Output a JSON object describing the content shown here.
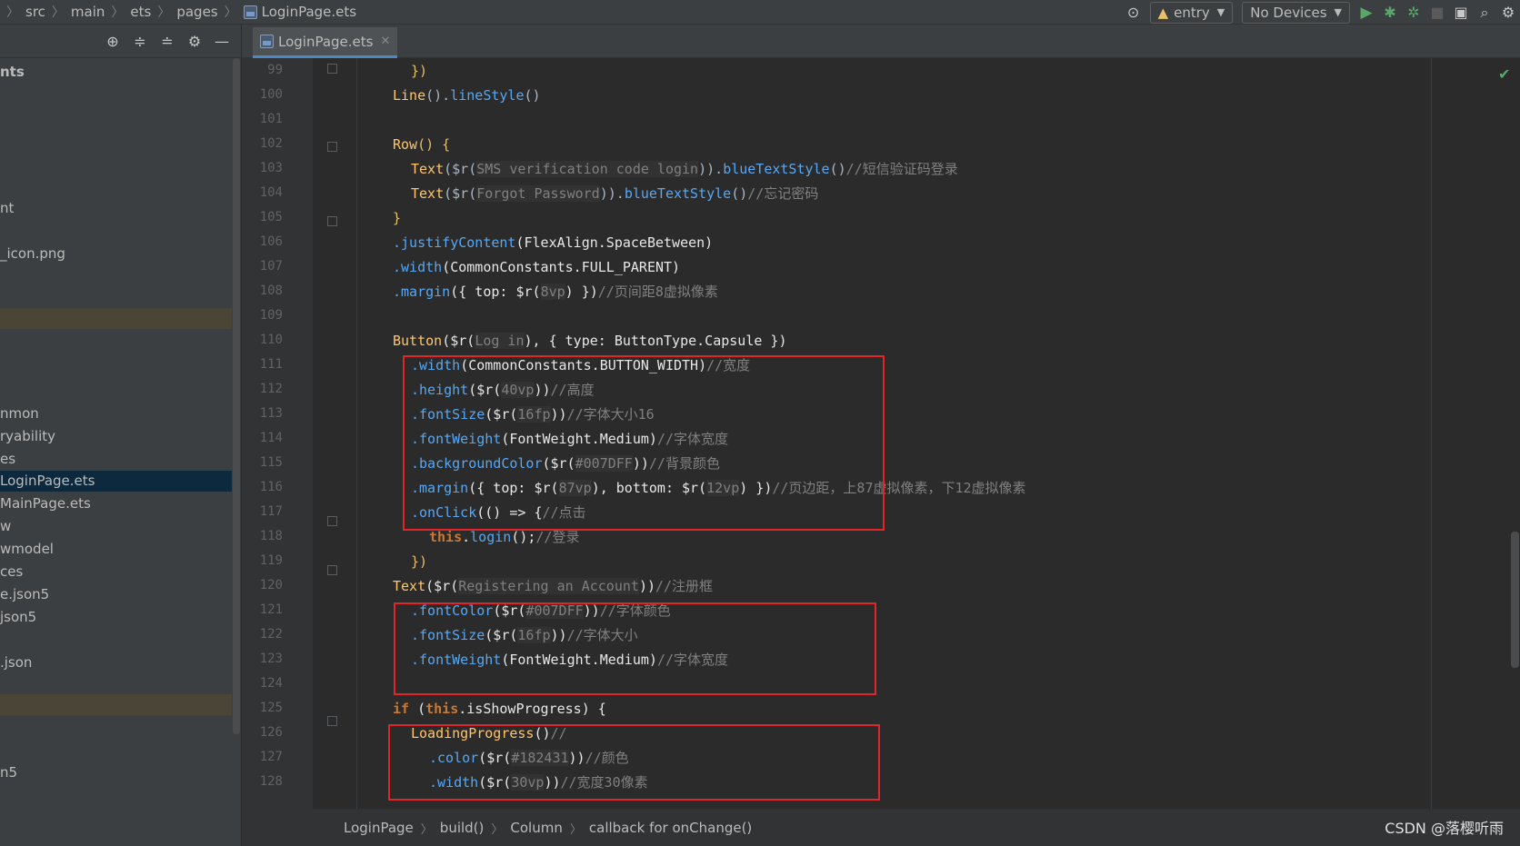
{
  "breadcrumbs": [
    "src",
    "main",
    "ets",
    "pages",
    "LoginPage.ets"
  ],
  "toolbar": {
    "module_select": "entry",
    "device_select": "No Devices"
  },
  "project_panel": {
    "rows": [
      {
        "text": "nts",
        "style": "bold"
      },
      {
        "text": "nt",
        "style": ""
      },
      {
        "text": "_icon.png",
        "style": ""
      },
      {
        "text": "",
        "style": "hl"
      },
      {
        "text": "nmon",
        "style": ""
      },
      {
        "text": "ryability",
        "style": ""
      },
      {
        "text": "es",
        "style": ""
      },
      {
        "text": "LoginPage.ets",
        "style": "sel"
      },
      {
        "text": "MainPage.ets",
        "style": ""
      },
      {
        "text": "w",
        "style": ""
      },
      {
        "text": "wmodel",
        "style": ""
      },
      {
        "text": "ces",
        "style": ""
      },
      {
        "text": "e.json5",
        "style": ""
      },
      {
        "text": "json5",
        "style": ""
      },
      {
        "text": ".json",
        "style": ""
      },
      {
        "text": "",
        "style": "hl"
      },
      {
        "text": "n5",
        "style": ""
      }
    ]
  },
  "editor": {
    "tab_label": "LoginPage.ets",
    "line_numbers": [
      "99",
      "100",
      "101",
      "102",
      "103",
      "104",
      "105",
      "106",
      "107",
      "108",
      "109",
      "110",
      "111",
      "112",
      "113",
      "114",
      "115",
      "116",
      "117",
      "118",
      "119",
      "120",
      "121",
      "122",
      "123",
      "124",
      "125",
      "126",
      "127",
      "128"
    ]
  },
  "code": {
    "l99": "})",
    "l100_a": "Line",
    "l100_b": "().",
    "l100_c": "lineStyle",
    "l100_d": "()",
    "l102_a": "Row",
    "l102_b": "() {",
    "l103_a": "Text",
    "l103_b": "($r(",
    "l103_c": "SMS verification code login",
    "l103_d": ")).",
    "l103_e": "blueTextStyle",
    "l103_f": "()",
    "l103_g": "//短信验证码登录",
    "l104_a": "Text",
    "l104_b": "($r(",
    "l104_c": "Forgot Password",
    "l104_d": ")).",
    "l104_e": "blueTextStyle",
    "l104_f": "()",
    "l104_g": "//忘记密码",
    "l105": "}",
    "l106_a": ".justifyContent",
    "l106_b": "(FlexAlign.SpaceBetween)",
    "l107_a": ".width",
    "l107_b": "(CommonConstants.FULL_PARENT)",
    "l108_a": ".margin",
    "l108_b": "({ top: $r(",
    "l108_c": "8vp",
    "l108_d": ") })",
    "l108_e": "//页间距8虚拟像素",
    "l110_a": "Button",
    "l110_b": "($r(",
    "l110_c": "Log in",
    "l110_d": "), { type: ButtonType.Capsule })",
    "l111_a": ".width",
    "l111_b": "(CommonConstants.BUTTON_WIDTH)",
    "l111_c": "//宽度",
    "l112_a": ".height",
    "l112_b": "($r(",
    "l112_c": "40vp",
    "l112_d": "))",
    "l112_e": "//高度",
    "l113_a": ".fontSize",
    "l113_b": "($r(",
    "l113_c": "16fp",
    "l113_d": "))",
    "l113_e": "//字体大小16",
    "l114_a": ".fontWeight",
    "l114_b": "(FontWeight.Medium)",
    "l114_c": "//字体宽度",
    "l115_a": ".backgroundColor",
    "l115_b": "($r(",
    "l115_c": "#007DFF",
    "l115_d": "))",
    "l115_e": "//背景颜色",
    "l116_a": ".margin",
    "l116_b": "({ top: $r(",
    "l116_c": "87vp",
    "l116_d": "), bottom: $r(",
    "l116_e": "12vp",
    "l116_f": ") })",
    "l116_g": "//页边距，上87虚拟像素，下12虚拟像素",
    "l117_a": ".onClick",
    "l117_b": "(() => {",
    "l117_c": "//点击",
    "l118_a": "this",
    "l118_b": ".",
    "l118_c": "login",
    "l118_d": "();",
    "l118_e": "//登录",
    "l119": "})",
    "l120_a": "Text",
    "l120_b": "($r(",
    "l120_c": "Registering an Account",
    "l120_d": "))",
    "l120_e": "//注册框",
    "l121_a": ".fontColor",
    "l121_b": "($r(",
    "l121_c": "#007DFF",
    "l121_d": "))",
    "l121_e": "//字体颜色",
    "l122_a": ".fontSize",
    "l122_b": "($r(",
    "l122_c": "16fp",
    "l122_d": "))",
    "l122_e": "//字体大小",
    "l123_a": ".fontWeight",
    "l123_b": "(FontWeight.Medium)",
    "l123_c": "//字体宽度",
    "l125_a": "if",
    "l125_b": " (",
    "l125_c": "this",
    "l125_d": ".isShowProgress) {",
    "l126_a": "LoadingProgress",
    "l126_b": "()",
    "l126_c": "//",
    "l127_a": ".color",
    "l127_b": "($r(",
    "l127_c": "#182431",
    "l127_d": "))",
    "l127_e": "//颜色",
    "l128_a": ".width",
    "l128_b": "($r(",
    "l128_c": "30vp",
    "l128_d": "))",
    "l128_e": "//宽度30像素"
  },
  "bottom_breadcrumb": [
    "LoginPage",
    "build()",
    "Column",
    "callback for onChange()"
  ],
  "watermark": "CSDN @落樱听雨",
  "colors": {
    "annotation_box": "#e0262b",
    "keyword": "#cc7832",
    "function": "#ffc66d",
    "comment": "#808080",
    "selected_row": "#0d293e"
  }
}
